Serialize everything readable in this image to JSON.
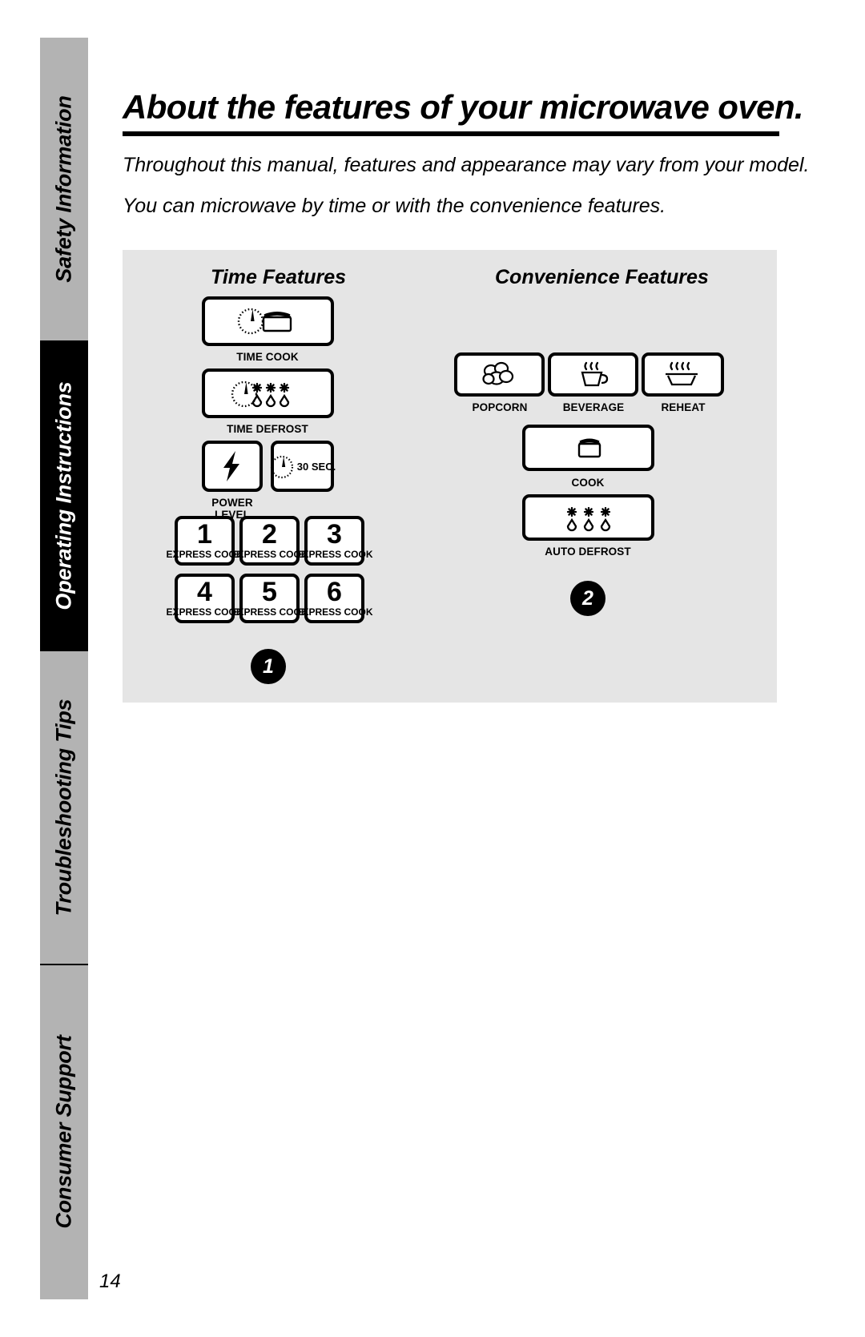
{
  "sidebar": {
    "tabs": [
      {
        "label": "Safety Information",
        "active": false
      },
      {
        "label": "Operating Instructions",
        "active": true
      },
      {
        "label": "Troubleshooting Tips",
        "active": false
      },
      {
        "label": "Consumer Support",
        "active": false
      }
    ]
  },
  "header": {
    "title": "About the features of your microwave oven.",
    "intro_1": "Throughout this manual, features and appearance may vary from your model.",
    "intro_2": "You can microwave by time or with the convenience features."
  },
  "panel": {
    "time_features": {
      "heading": "Time Features",
      "buttons": [
        {
          "caption": "TIME COOK",
          "icon": "clock-pot-icon"
        },
        {
          "caption": "TIME DEFROST",
          "icon": "clock-snowflake-drop-icon"
        },
        {
          "caption": "POWER\nLEVEL",
          "icon": "lightning-bolt-icon"
        },
        {
          "caption": "",
          "icon": "clock-30sec-icon",
          "inner_label": "30 SEC."
        }
      ],
      "express_cook": [
        {
          "number": "1",
          "label": "EXPRESS COOK"
        },
        {
          "number": "2",
          "label": "EXPRESS COOK"
        },
        {
          "number": "3",
          "label": "EXPRESS COOK"
        },
        {
          "number": "4",
          "label": "EXPRESS COOK"
        },
        {
          "number": "5",
          "label": "EXPRESS COOK"
        },
        {
          "number": "6",
          "label": "EXPRESS COOK"
        }
      ],
      "marker": "1"
    },
    "convenience_features": {
      "heading": "Convenience Features",
      "buttons": [
        {
          "caption": "POPCORN",
          "icon": "popcorn-icon"
        },
        {
          "caption": "BEVERAGE",
          "icon": "steaming-cup-icon"
        },
        {
          "caption": "REHEAT",
          "icon": "steaming-plate-icon"
        },
        {
          "caption": "COOK",
          "icon": "pot-icon"
        },
        {
          "caption": "AUTO DEFROST",
          "icon": "snowflake-drop-icon"
        }
      ],
      "marker": "2"
    }
  },
  "footer": {
    "page_number": "14"
  },
  "colors": {
    "sidebar_inactive": "#b3b3b3",
    "sidebar_active": "#000000",
    "panel_background": "#e5e5e5",
    "ink": "#000000"
  }
}
